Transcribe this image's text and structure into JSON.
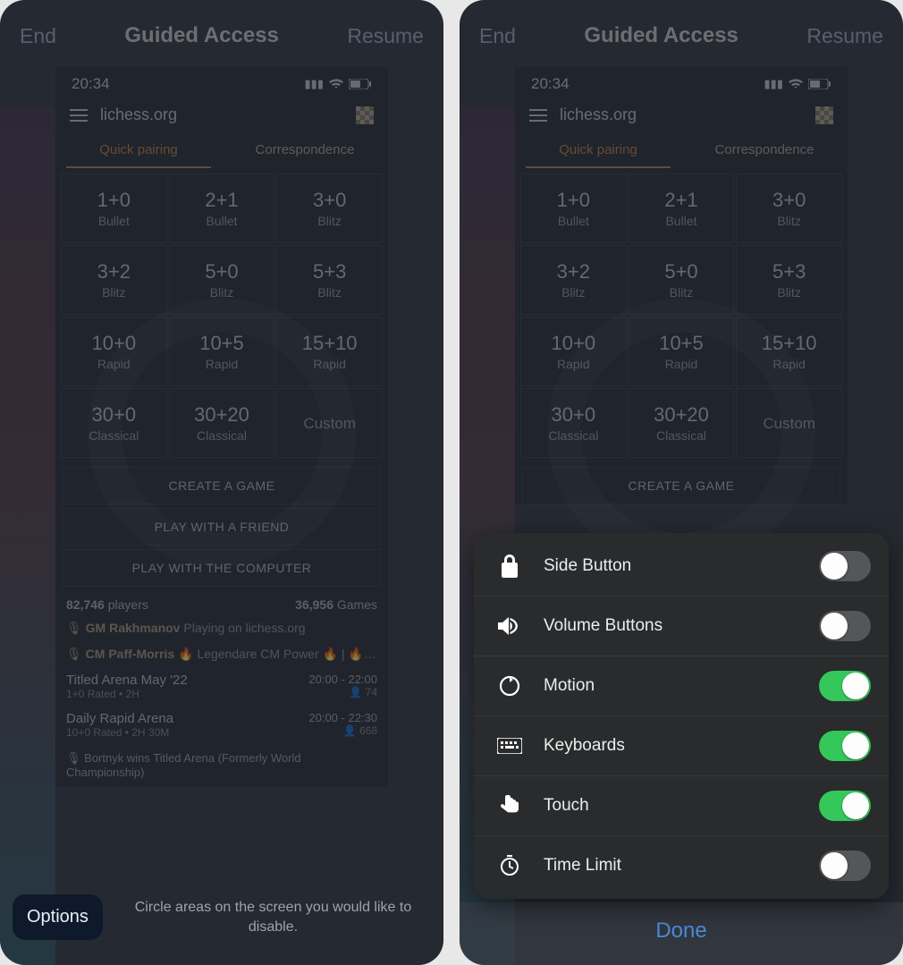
{
  "guided_access": {
    "end_label": "End",
    "title": "Guided Access",
    "resume_label": "Resume",
    "options_button": "Options",
    "circle_hint": "Circle areas on the screen you would like to disable.",
    "done_label": "Done"
  },
  "statusbar": {
    "time": "20:34"
  },
  "app": {
    "site": "lichess.org",
    "tabs": {
      "quick_pairing": "Quick pairing",
      "correspondence": "Correspondence"
    },
    "tiles": [
      {
        "tc": "1+0",
        "mode": "Bullet"
      },
      {
        "tc": "2+1",
        "mode": "Bullet"
      },
      {
        "tc": "3+0",
        "mode": "Blitz"
      },
      {
        "tc": "3+2",
        "mode": "Blitz"
      },
      {
        "tc": "5+0",
        "mode": "Blitz"
      },
      {
        "tc": "5+3",
        "mode": "Blitz"
      },
      {
        "tc": "10+0",
        "mode": "Rapid"
      },
      {
        "tc": "10+5",
        "mode": "Rapid"
      },
      {
        "tc": "15+10",
        "mode": "Rapid"
      },
      {
        "tc": "30+0",
        "mode": "Classical"
      },
      {
        "tc": "30+20",
        "mode": "Classical"
      },
      {
        "tc": "",
        "mode": "Custom"
      }
    ],
    "buttons": {
      "create_game": "CREATE A GAME",
      "play_friend": "PLAY WITH A FRIEND",
      "play_computer": "PLAY WITH THE COMPUTER"
    },
    "stats": {
      "players_count": "82,746",
      "players_label": "players",
      "games_count": "36,956",
      "games_label": "Games"
    },
    "feed": {
      "line1_user": "GM Rakhmanov",
      "line1_rest": "Playing on lichess.org",
      "line2_user": "CM Paff-Morris",
      "line2_rest": "🔥  Legendare CM Power 🔥 |  🔥 Sonnt..."
    },
    "arenas": [
      {
        "title": "Titled Arena May '22",
        "meta": "1+0 Rated • 2H",
        "time": "20:00 - 22:00",
        "count": "74"
      },
      {
        "title": "Daily Rapid Arena",
        "meta": "10+0 Rated • 2H 30M",
        "time": "20:00 - 22:30",
        "count": "668"
      }
    ],
    "news": "Bortnyk wins Titled Arena (Formerly World Championship)"
  },
  "options_panel": {
    "items": [
      {
        "icon": "lock-icon",
        "label": "Side Button",
        "on": false
      },
      {
        "icon": "volume-icon",
        "label": "Volume Buttons",
        "on": false
      },
      {
        "icon": "motion-icon",
        "label": "Motion",
        "on": true
      },
      {
        "icon": "keyboard-icon",
        "label": "Keyboards",
        "on": true
      },
      {
        "icon": "touch-icon",
        "label": "Touch",
        "on": true
      },
      {
        "icon": "timer-icon",
        "label": "Time Limit",
        "on": false
      }
    ]
  }
}
